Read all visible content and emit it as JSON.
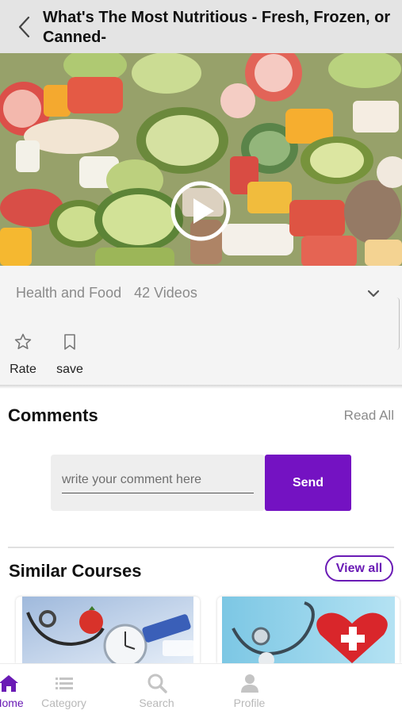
{
  "header": {
    "title": "What's The Most Nutritious - Fresh, Frozen, or Canned-"
  },
  "video": {
    "play_icon": "play-circle-icon"
  },
  "course_info": {
    "category": "Health and Food",
    "video_count": "42 Videos",
    "expand_icon": "chevron-down-icon",
    "actions": [
      {
        "label": "Rate",
        "icon": "star-outline-icon"
      },
      {
        "label": "save",
        "icon": "bookmark-outline-icon"
      }
    ]
  },
  "comments": {
    "title": "Comments",
    "read_all": "Read All",
    "input_placeholder": "write your comment here",
    "send_label": "Send"
  },
  "similar_courses": {
    "title": "Similar Courses",
    "view_all": "View all",
    "cards": [
      {
        "image": "stethoscope-tomato-clock-image"
      },
      {
        "image": "stethoscope-heart-image"
      }
    ]
  },
  "bottom_nav": {
    "items": [
      {
        "label": "Home",
        "icon": "home-icon",
        "active": true
      },
      {
        "label": "Category",
        "icon": "list-icon",
        "active": false
      },
      {
        "label": "Search",
        "icon": "search-icon",
        "active": false
      },
      {
        "label": "Profile",
        "icon": "profile-icon",
        "active": false
      }
    ]
  },
  "colors": {
    "accent": "#7412c2",
    "header_bg": "#e4e4e4",
    "muted_text": "#8a8a8a"
  }
}
